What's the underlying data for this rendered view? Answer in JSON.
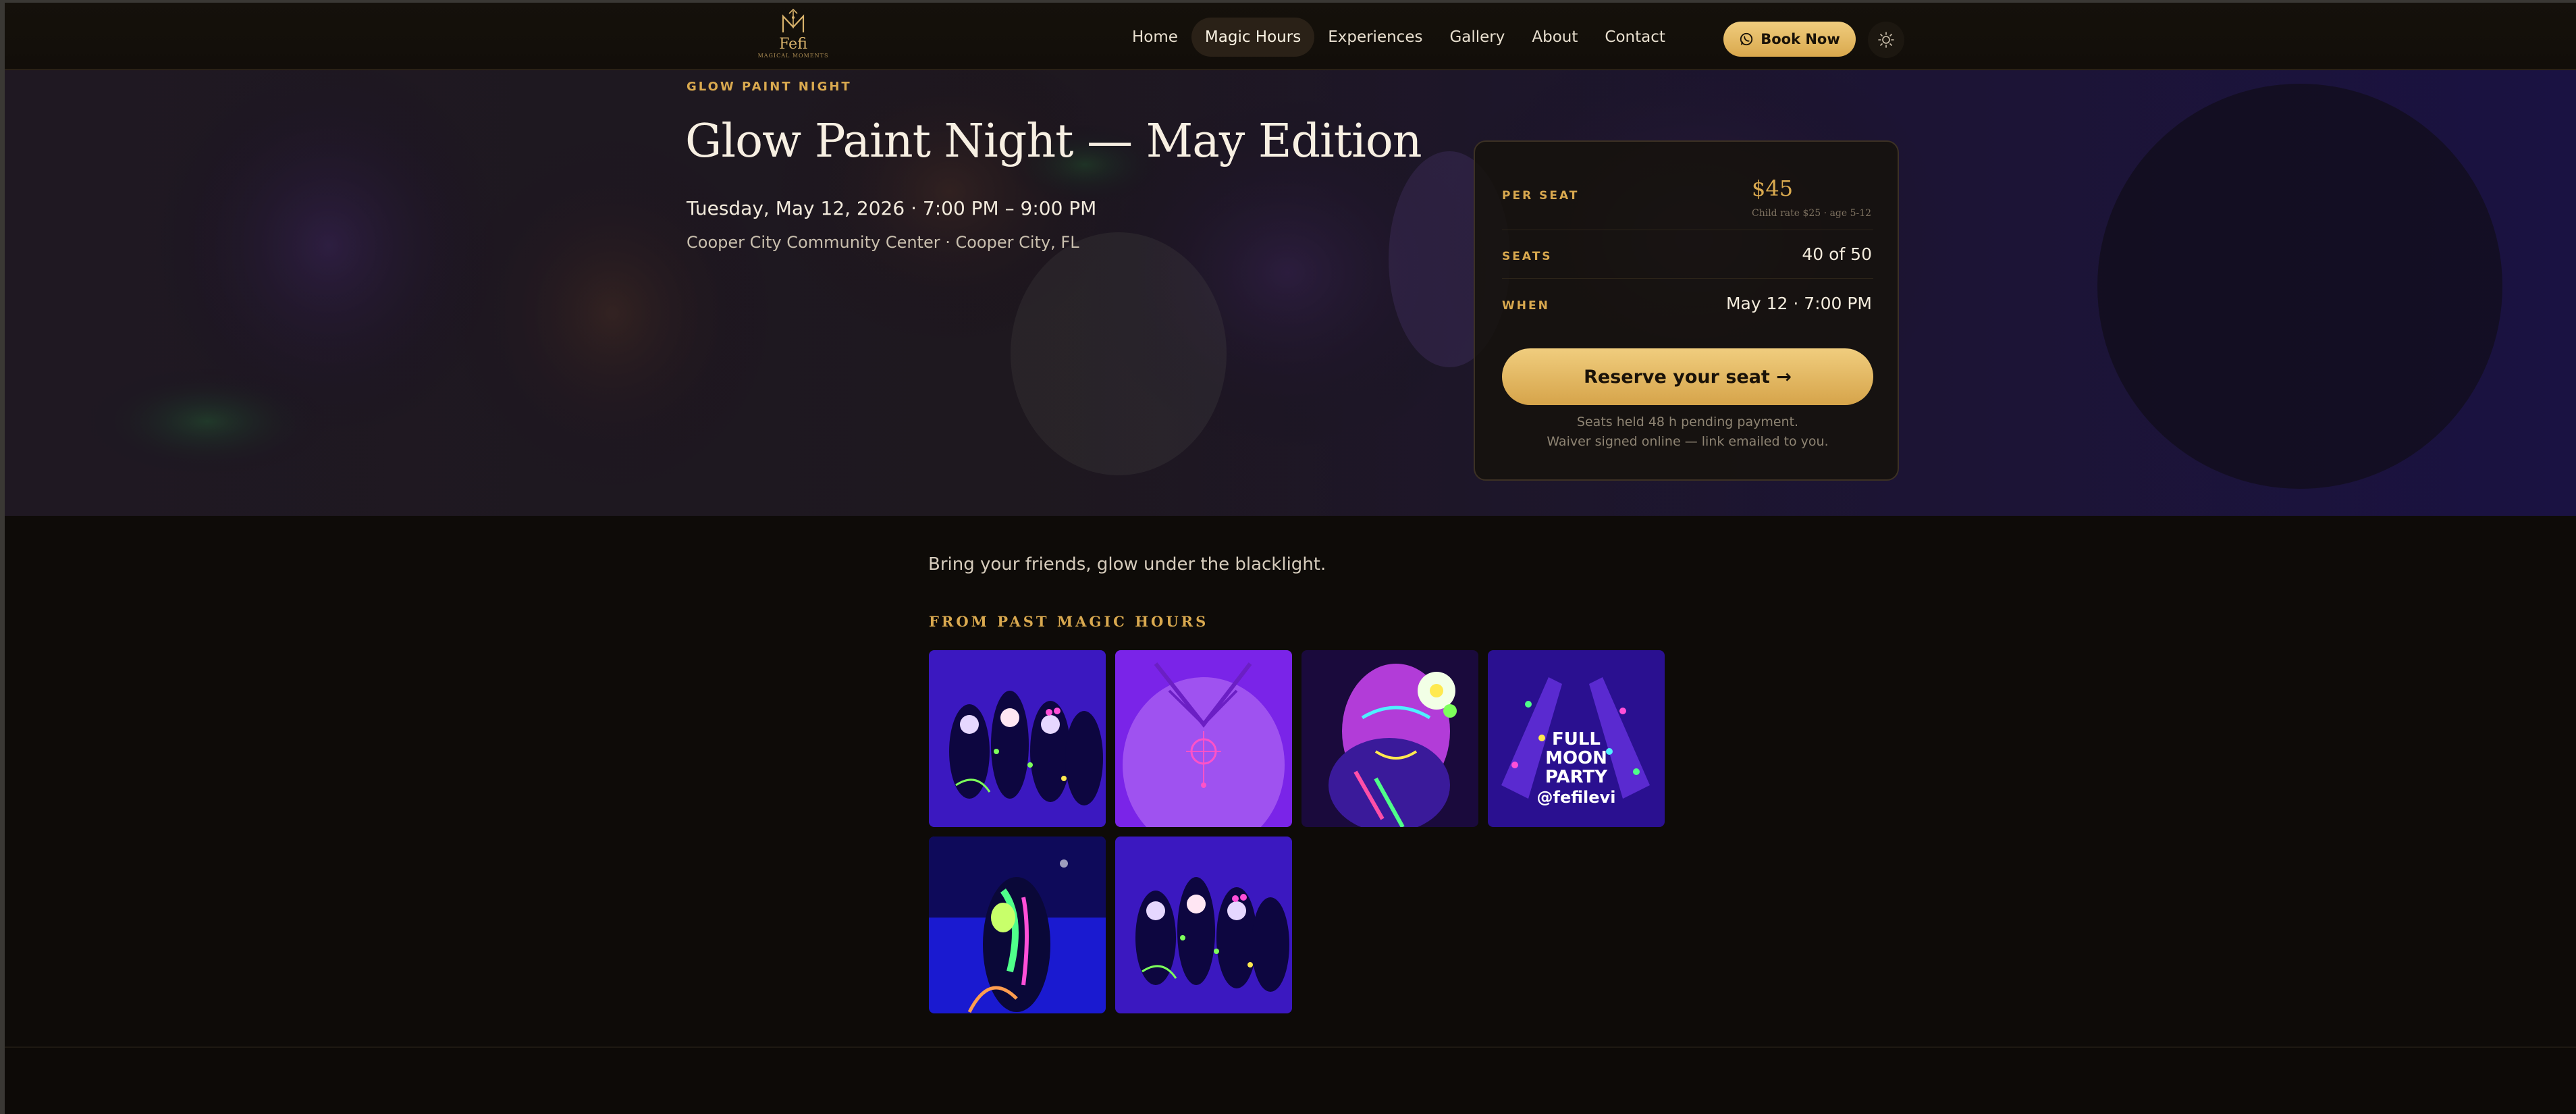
{
  "nav": {
    "logo": {
      "name": "Fefi",
      "tagline": "MAGICAL MOMENTS"
    },
    "links": [
      {
        "label": "Home",
        "active": false
      },
      {
        "label": "Magic Hours",
        "active": true
      },
      {
        "label": "Experiences",
        "active": false
      },
      {
        "label": "Gallery",
        "active": false
      },
      {
        "label": "About",
        "active": false
      },
      {
        "label": "Contact",
        "active": false
      }
    ],
    "book_label": "Book Now",
    "book_icon": "whatsapp-icon",
    "theme_icon": "sun-icon"
  },
  "event": {
    "eyebrow": "GLOW PAINT NIGHT",
    "title": "Glow Paint Night — May Edition",
    "datetime": "Tuesday, May 12, 2026 · 7:00 PM – 9:00 PM",
    "location": "Cooper City Community Center · Cooper City, FL",
    "description": "Bring your friends, glow under the blacklight."
  },
  "booking": {
    "per_seat_label": "PER SEAT",
    "price": "$45",
    "child_rate": "Child rate $25 · age 5-12",
    "seats_label": "SEATS",
    "seats_value": "40 of 50",
    "when_label": "WHEN",
    "when_value": "May 12 · 7:00 PM",
    "reserve_label": "Reserve your seat →",
    "note_line1": "Seats held 48 h pending payment.",
    "note_line2": "Waiver signed online — link emailed to you."
  },
  "gallery": {
    "heading": "FROM PAST MAGIC HOURS",
    "images": [
      {
        "name": "uv-group-photo"
      },
      {
        "name": "uv-back-paint"
      },
      {
        "name": "uv-face-paint"
      },
      {
        "name": "full-moon-party-hands",
        "overlay": [
          "FULL",
          "MOON",
          "PARTY",
          "@fefilevi"
        ]
      },
      {
        "name": "uv-dancer"
      },
      {
        "name": "uv-group-photo-2"
      }
    ]
  },
  "colors": {
    "accent": "#d9a94f",
    "button_gold": "#e8bf68",
    "background": "#0e0b08"
  }
}
